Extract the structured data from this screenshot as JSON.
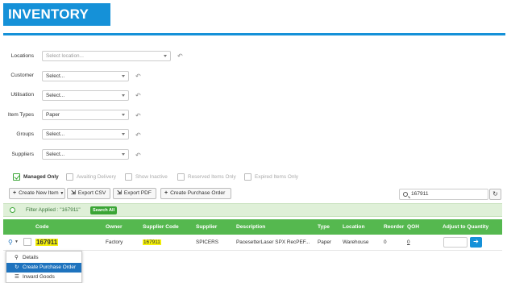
{
  "header": {
    "title": "INVENTORY"
  },
  "filters": {
    "locations": {
      "label": "Locations",
      "placeholder": "Select location..."
    },
    "customer": {
      "label": "Customer",
      "value": "Select..."
    },
    "utilisation": {
      "label": "Utilisation",
      "value": "Select..."
    },
    "item_types": {
      "label": "Item Types",
      "value": "Paper"
    },
    "groups": {
      "label": "Groups",
      "value": "Select..."
    },
    "suppliers": {
      "label": "Suppliers",
      "value": "Select..."
    }
  },
  "checkboxes": [
    {
      "label": "Managed Only",
      "checked": true
    },
    {
      "label": "Awaiting Delivery",
      "checked": false
    },
    {
      "label": "Show Inactive",
      "checked": false
    },
    {
      "label": "Reserved Items Only",
      "checked": false
    },
    {
      "label": "Expired Items Only",
      "checked": false
    }
  ],
  "toolbar": {
    "create_new_item": "Create New Item",
    "export_csv": "Export CSV",
    "export_pdf": "Export PDF",
    "create_purchase_order": "Create Purchase Order",
    "search_value": "167911"
  },
  "filter_bar": {
    "text": "Filter Applied : \"167911\"",
    "search_all": "Search All"
  },
  "table": {
    "headers": {
      "code": "Code",
      "owner": "Owner",
      "supplier_code": "Supplier Code",
      "supplier": "Supplier",
      "description": "Description",
      "type": "Type",
      "location": "Location",
      "reorder": "Reorder",
      "qoh": "QOH",
      "adjust": "Adjust to Quantity"
    },
    "rows": [
      {
        "code": "167911",
        "owner": "Factory",
        "supplier_code": "167911",
        "supplier": "SPICERS",
        "description": "PacesetterLaser SPX RecPEF...",
        "type": "Paper",
        "location": "Warehouse",
        "reorder": "0",
        "qoh": "0"
      }
    ]
  },
  "row_menu": {
    "items": [
      {
        "label": "Details",
        "icon": "search-icon"
      },
      {
        "label": "Create Purchase Order",
        "icon": "refresh-icon"
      },
      {
        "label": "Inward Goods",
        "icon": "list-icon"
      }
    ]
  },
  "colors": {
    "brand": "#1591d8",
    "table_header": "#55b84f",
    "highlight": "#f4f00a",
    "menu_active": "#1e73be"
  }
}
